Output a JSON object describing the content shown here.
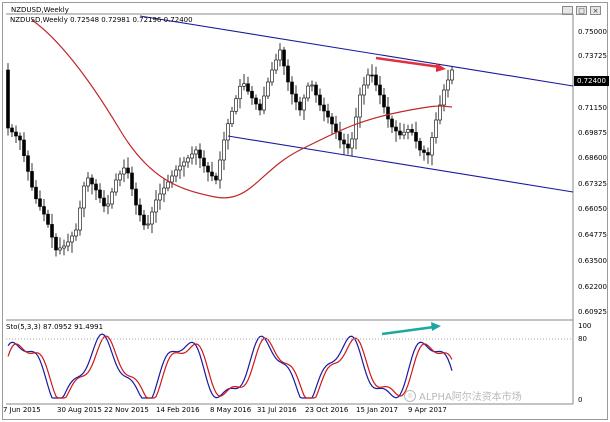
{
  "window": {
    "title": "NZDUSD,Weekly",
    "controls": [
      "_",
      "□",
      "×"
    ]
  },
  "main_panel": {
    "header": "NZDUSD,Weekly  0.72548 0.72981 0.72196 0.72400",
    "current_price": "0.72400",
    "price_labels": [
      "0.75000",
      "0.73725",
      "0.71150",
      "0.69875",
      "0.68600",
      "0.67325",
      "0.66050",
      "0.64775",
      "0.63500",
      "0.62200",
      "0.60925"
    ]
  },
  "stoch_panel": {
    "header": "Sto(5,3,3) 87.0952 91.4991",
    "labels": [
      "100",
      "80",
      "0"
    ]
  },
  "x_axis": {
    "labels": [
      "7 Jun 2015",
      "30 Aug 2015",
      "22 Nov 2015",
      "14 Feb 2016",
      "8 May 2016",
      "31 Jul 2016",
      "23 Oct 2016",
      "15 Jan 2017",
      "9 Apr 2017"
    ]
  },
  "watermark": {
    "text": "ALPHA阿尔法资本市场"
  },
  "colors": {
    "channel": "#1a1aa0",
    "ma": "#c0282a",
    "arrow_red": "#e03040",
    "arrow_teal": "#1aa8a0",
    "stoch_main": "#1a1aa0",
    "stoch_signal": "#d01818"
  }
}
